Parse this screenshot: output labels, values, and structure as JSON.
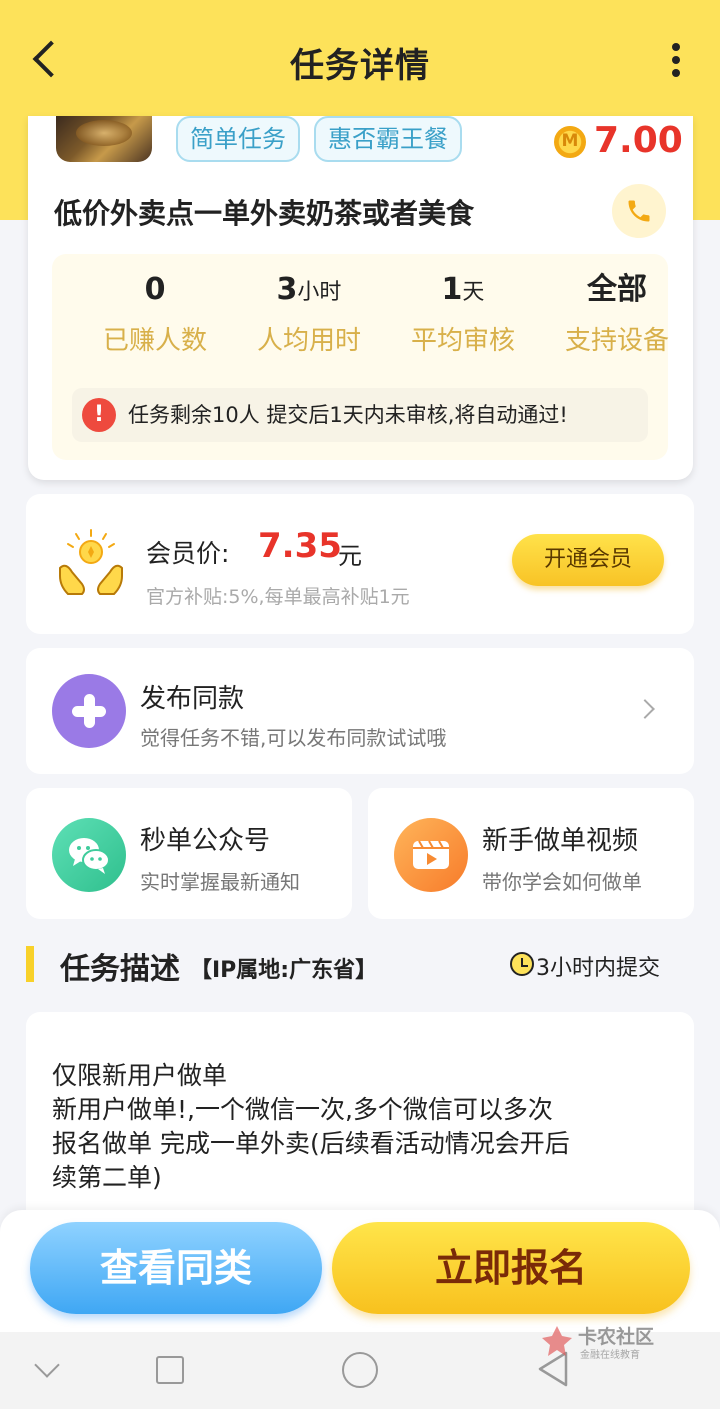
{
  "header": {
    "title": "任务详情"
  },
  "task": {
    "tags": [
      "简单任务",
      "惠否霸王餐"
    ],
    "coin_symbol": "M",
    "price": "7.00",
    "title": "低价外卖点一单外卖奶茶或者美食",
    "stats": [
      {
        "value": "0",
        "unit": "",
        "label": "已赚人数"
      },
      {
        "value": "3",
        "unit": "小时",
        "label": "人均用时"
      },
      {
        "value": "1",
        "unit": "天",
        "label": "平均审核"
      },
      {
        "value": "全部",
        "unit": "",
        "label": "支持设备"
      }
    ],
    "notice": "任务剩余10人  提交后1天内未审核,将自动通过!"
  },
  "membership": {
    "label": "会员价:",
    "price": "7.35",
    "unit": "元",
    "subsidy": "官方补贴:5%,每单最高补贴1元",
    "button": "开通会员"
  },
  "publish": {
    "title": "发布同款",
    "subtitle": "觉得任务不错,可以发布同款试试哦"
  },
  "quick_links": [
    {
      "title": "秒单公众号",
      "subtitle": "实时掌握最新通知"
    },
    {
      "title": "新手做单视频",
      "subtitle": "带你学会如何做单"
    }
  ],
  "description": {
    "title": "任务描述",
    "ip": "【IP属地:广东省】",
    "submit_time": "3小时内提交",
    "lines": [
      "仅限新用户做单",
      "新用户做单!,一个微信一次,多个微信可以多次",
      "报名做单 完成一单外卖(后续看活动情况会开后",
      "续第二单)"
    ]
  },
  "actions": {
    "similar": "查看同类",
    "signup": "立即报名"
  },
  "watermark": {
    "main": "卡农社区",
    "sub": "金融在线教育"
  },
  "colors": {
    "header_bg": "#fde25a",
    "price_red": "#e8342a",
    "stat_label": "#d8b04a",
    "signup_text": "#7a2a08"
  }
}
